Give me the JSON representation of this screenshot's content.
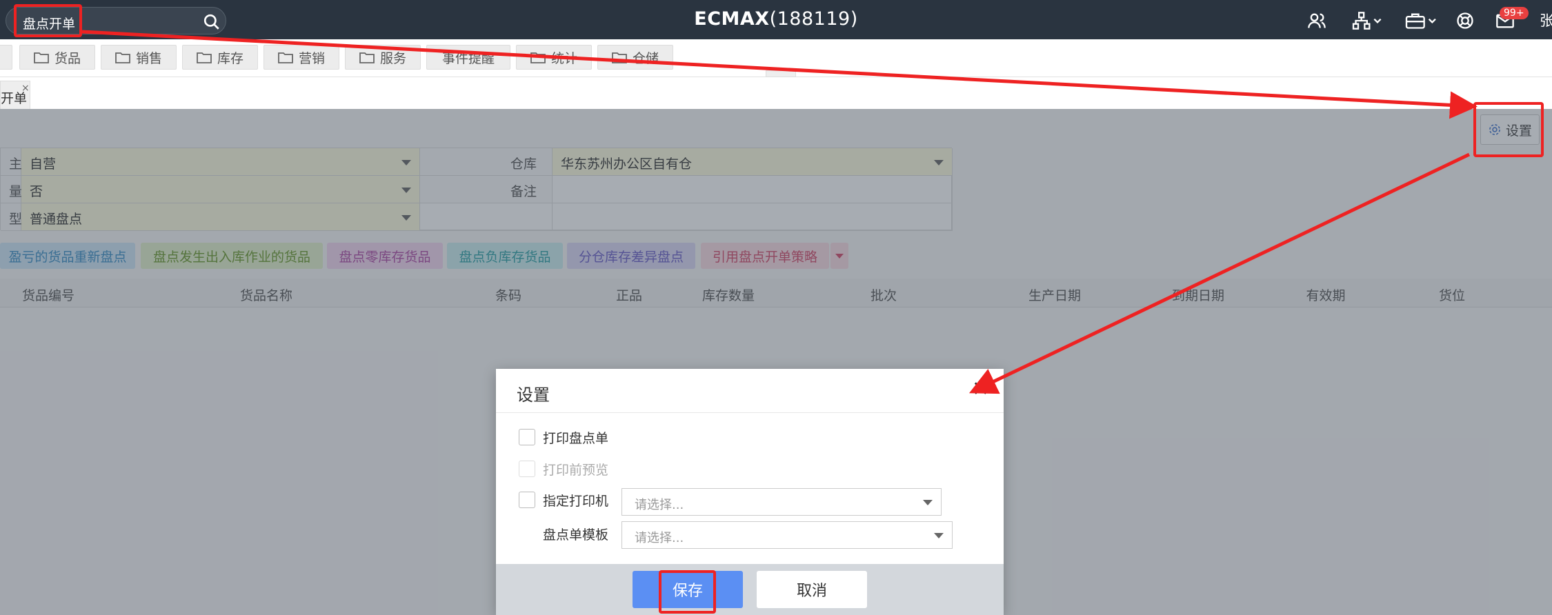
{
  "topbar": {
    "search_value": "盘点开单",
    "title_bold": "ECMAX",
    "title_rest": "(188119)",
    "badge": "99+",
    "user_initial": "张",
    "icons": [
      "users-icon",
      "org-chart-icon",
      "briefcase-icon",
      "support-icon",
      "mail-icon"
    ]
  },
  "menu": {
    "items": [
      {
        "label": "货品",
        "folder": true
      },
      {
        "label": "销售",
        "folder": true
      },
      {
        "label": "库存",
        "folder": true
      },
      {
        "label": "营销",
        "folder": true
      },
      {
        "label": "服务",
        "folder": true
      },
      {
        "label": "事件提醒",
        "folder": false
      },
      {
        "label": "统计",
        "folder": true
      },
      {
        "label": "仓储",
        "folder": true
      }
    ]
  },
  "tab": {
    "label": "开单",
    "close": "×"
  },
  "settings_button": "设置",
  "form": {
    "row1": {
      "label": "主",
      "value": "自营",
      "label2": "仓库",
      "value2": "华东苏州办公区自有仓"
    },
    "row2": {
      "label": "量",
      "value": "否",
      "label2": "备注",
      "value2": ""
    },
    "row3": {
      "label": "型",
      "value": "普通盘点"
    }
  },
  "actions": [
    {
      "label": "盈亏的货品重新盘点",
      "bg": "#cfe8f8",
      "fg": "#3a8fc6"
    },
    {
      "label": "盘点发生出入库作业的货品",
      "bg": "#e4f2cc",
      "fg": "#6a9a2a"
    },
    {
      "label": "盘点零库存货品",
      "bg": "#f5d8f0",
      "fg": "#b04aa6"
    },
    {
      "label": "盘点负库存货品",
      "bg": "#cdeff0",
      "fg": "#2aa0a6"
    },
    {
      "label": "分仓库存差异盘点",
      "bg": "#dcd9f6",
      "fg": "#6a5ec8"
    },
    {
      "label": "引用盘点开单策略",
      "bg": "#fbdde4",
      "fg": "#d6496a"
    }
  ],
  "grid_headers": [
    "货品编号",
    "货品名称",
    "条码",
    "正品",
    "库存数量",
    "批次",
    "生产日期",
    "到期日期",
    "有效期",
    "货位"
  ],
  "dialog": {
    "title": "设置",
    "close": "✕",
    "opt_print": "打印盘点单",
    "opt_preview": "打印前预览",
    "opt_printer": "指定打印机",
    "template_label": "盘点单模板",
    "printer_placeholder": "请选择...",
    "template_placeholder": "请选择...",
    "save": "保存",
    "cancel": "取消"
  },
  "colors": {
    "annotation_red": "#ee2222",
    "save_blue": "#5b8ff3",
    "topbar": "#2a3440"
  }
}
